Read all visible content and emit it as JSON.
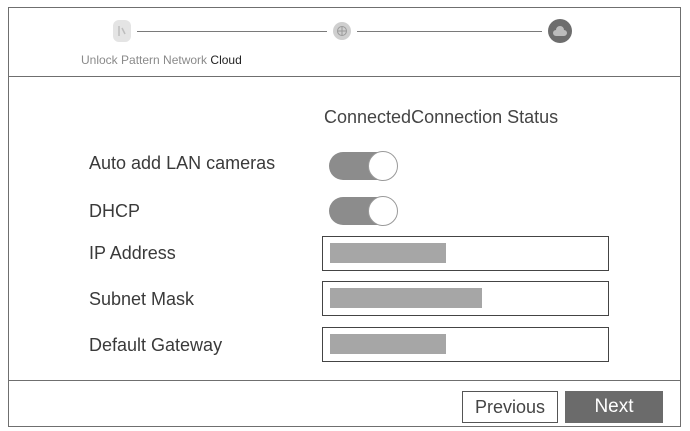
{
  "wizard": {
    "steps": [
      {
        "label": "Unlock Pattern",
        "icon": "unlock-pattern-icon"
      },
      {
        "label": "Network",
        "icon": "network-globe-icon"
      },
      {
        "label": "Cloud",
        "icon": "cloud-icon"
      }
    ],
    "active_step": "Cloud"
  },
  "status": {
    "value": "Connected",
    "label": "Connection Status"
  },
  "form": {
    "auto_add_label": "Auto add LAN cameras",
    "auto_add_on": true,
    "dhcp_label": "DHCP",
    "dhcp_on": true,
    "ip_label": "IP Address",
    "subnet_label": "Subnet Mask",
    "gateway_label": "Default Gateway"
  },
  "buttons": {
    "previous": "Previous",
    "next": "Next"
  },
  "colors": {
    "toggle_on": "#8c8c8c",
    "next_button": "#6b6b6b",
    "redacted_fill": "#a6a6a6"
  }
}
